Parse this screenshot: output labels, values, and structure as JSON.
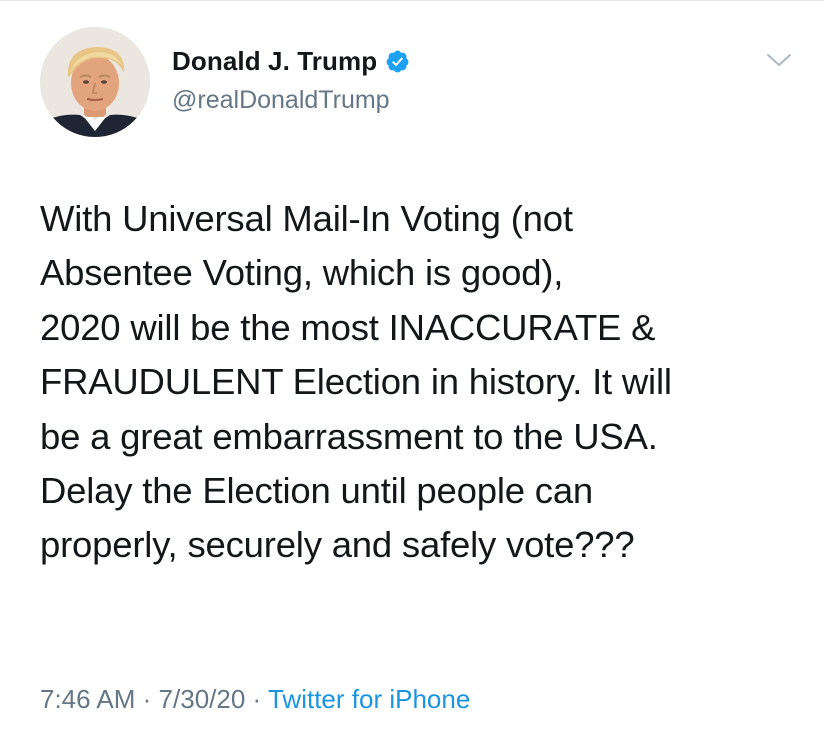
{
  "tweet": {
    "author": {
      "display_name": "Donald J. Trump",
      "handle": "@realDonaldTrump",
      "verified": true,
      "avatar_icon": "profile-photo-avatar"
    },
    "menu_icon": "chevron-down-icon",
    "text": "With Universal Mail-In Voting (not\nAbsentee Voting, which is good),\n2020 will be the most INACCURATE &\nFRAUDULENT Election in history. It will\nbe a great embarrassment to the USA.\nDelay the Election until people can\nproperly, securely and safely vote???",
    "time": "7:46 AM",
    "separator": "·",
    "date": "7/30/20",
    "source": "Twitter for iPhone"
  },
  "colors": {
    "text": "#14171a",
    "secondary": "#657786",
    "link": "#1b95e0",
    "verified_badge": "#1da1f2"
  }
}
